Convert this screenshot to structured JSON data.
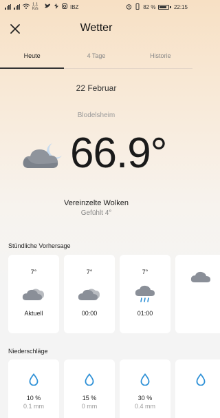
{
  "status_bar": {
    "network_speed": "1.1 K/s",
    "apps": "IBZ",
    "battery_percent": "82 %",
    "battery_level": 0.82,
    "time": "22:15"
  },
  "header": {
    "title": "Wetter",
    "close_icon": "close-icon"
  },
  "tabs": [
    {
      "label": "Heute",
      "active": true
    },
    {
      "label": "4 Tage",
      "active": false
    },
    {
      "label": "Historie",
      "active": false
    }
  ],
  "today": {
    "date": "22 Februar",
    "location": "Blodelsheim",
    "temperature": "66.9°",
    "condition": "Vereinzelte Wolken",
    "feels_like": "Gefühlt 4°",
    "icon": "partly-cloudy-night-icon"
  },
  "hourly": {
    "title": "Stündliche Vorhersage",
    "items": [
      {
        "temp": "7°",
        "time": "Aktuell",
        "icon": "cloudy-night-icon"
      },
      {
        "temp": "7°",
        "time": "00:00",
        "icon": "cloudy-night-icon"
      },
      {
        "temp": "7°",
        "time": "01:00",
        "icon": "rain-cloud-icon"
      },
      {
        "temp": "",
        "time": "",
        "icon": "cloud-icon"
      }
    ]
  },
  "precipitation": {
    "title": "Niederschläge",
    "items": [
      {
        "percent": "10 %",
        "amount": "0.1 mm"
      },
      {
        "percent": "15 %",
        "amount": "0 mm"
      },
      {
        "percent": "30 %",
        "amount": "0.4 mm"
      },
      {
        "percent": "",
        "amount": ""
      }
    ]
  },
  "colors": {
    "drop": "#2b8fd6",
    "cloud": "#8a8f98",
    "moon": "#c8dcef"
  }
}
